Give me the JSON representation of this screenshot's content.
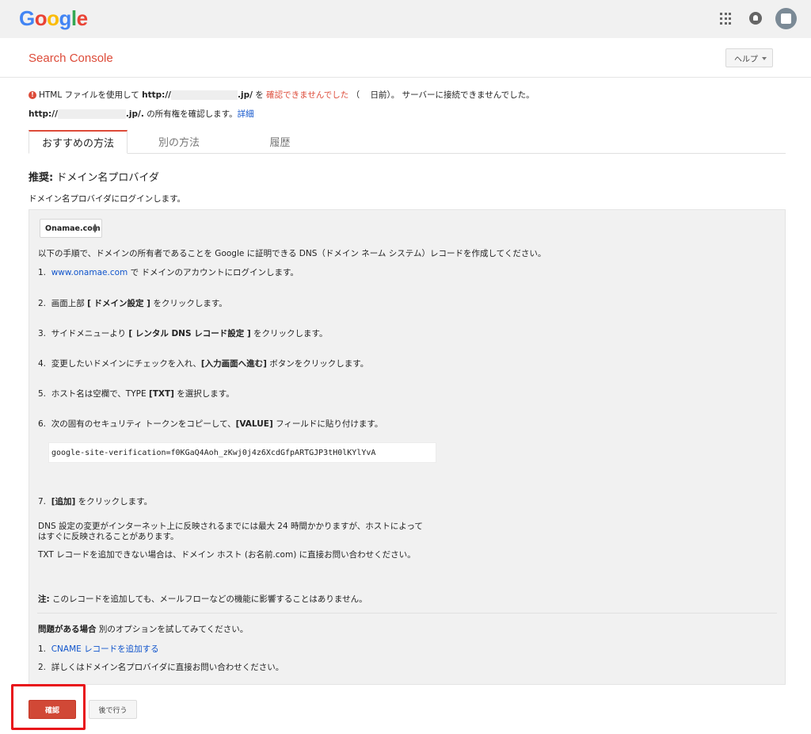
{
  "brand": {
    "letters": [
      "G",
      "o",
      "o",
      "g",
      "l",
      "e"
    ],
    "letter_colors": [
      "#4285f4",
      "#ea4335",
      "#fbbc05",
      "#4285f4",
      "#34a853",
      "#ea4335"
    ]
  },
  "header": {
    "app_title": "Search Console",
    "help_label": "ヘルプ",
    "icons": [
      "apps-icon",
      "notifications-icon",
      "account-icon"
    ]
  },
  "message": {
    "line1_prefix": "HTML ファイルを使用して",
    "url_prefix": "http://",
    "url_suffix": ".jp/",
    "particle": "を",
    "status": "確認できませんでした",
    "paren_open": "（",
    "days_ago": "日前）。",
    "server_error": "サーバーに接続できませんでした。",
    "line2_url_prefix": "http://",
    "line2_url_suffix": ".jp/.",
    "line2_text": "の所有権を確認します。",
    "details_link": "詳細"
  },
  "tabs": [
    {
      "label": "おすすめの方法",
      "active": true
    },
    {
      "label": "別の方法",
      "active": false
    },
    {
      "label": "履歴",
      "active": false
    }
  ],
  "section": {
    "title_bold": "推奨:",
    "title_rest": " ドメイン名プロバイダ",
    "subtitle": "ドメイン名プロバイダにログインします。"
  },
  "provider_select": {
    "value": "Onamae.com"
  },
  "instructions": {
    "intro": "以下の手順で、ドメインの所有者であることを Google に証明できる DNS（ドメイン ネーム システム）レコードを作成してください。",
    "step1_num": "1.",
    "step1_link": "www.onamae.com",
    "step1_rest": " で ドメインのアカウントにログインします。",
    "step2_num": "2.",
    "step2_pre": "画面上部 ",
    "step2_bold": "[ ドメイン設定 ]",
    "step2_post": " をクリックします。",
    "step3_num": "3.",
    "step3_pre": "サイドメニューより ",
    "step3_bold": "[ レンタル DNS レコード設定 ]",
    "step3_post": " をクリックします。",
    "step4_num": "4.",
    "step4_pre": "変更したいドメインにチェックを入れ、",
    "step4_bold": "[入力画面へ進む]",
    "step4_post": " ボタンをクリックします。",
    "step5_num": "5.",
    "step5_pre": "ホスト名は空欄で、TYPE ",
    "step5_bold": "[TXT]",
    "step5_post": " を選択します。",
    "step6_num": "6.",
    "step6_pre": "次の固有のセキュリティ トークンをコピーして、",
    "step6_bold": "[VALUE]",
    "step6_post": " フィールドに貼り付けます。",
    "token": "google-site-verification=f0KGaQ4Aoh_zKwj0j4z6XcdGfpARTGJP3tH0lKYlYvA",
    "step7_num": "7.",
    "step7_bold": "[追加]",
    "step7_post": " をクリックします。",
    "dns_note_line1": "DNS 設定の変更がインターネット上に反映されるまでには最大 24 時間かかりますが、ホストによって",
    "dns_note_line2": "はすぐに反映されることがあります。",
    "txt_note": "TXT レコードを追加できない場合は、ドメイン ホスト (お名前.com) に直接お問い合わせください。",
    "note_bold": "注:",
    "note_rest": " このレコードを追加しても、メールフローなどの機能に影響することはありません。",
    "problem_bold": "問題がある場合",
    "problem_rest": " 別のオプションを試してみてください。",
    "alt1_num": "1.",
    "alt1_link": "CNAME レコードを追加する",
    "alt2_num": "2.",
    "alt2_text": "詳しくはドメイン名プロバイダに直接お問い合わせください。"
  },
  "actions": {
    "confirm_label": "確認",
    "later_label": "後で行う"
  },
  "colors": {
    "accent_red": "#dd4b39",
    "link_blue": "#1155cc",
    "highlight_red": "#e8131a",
    "panel_bg": "#f1f1f1"
  }
}
